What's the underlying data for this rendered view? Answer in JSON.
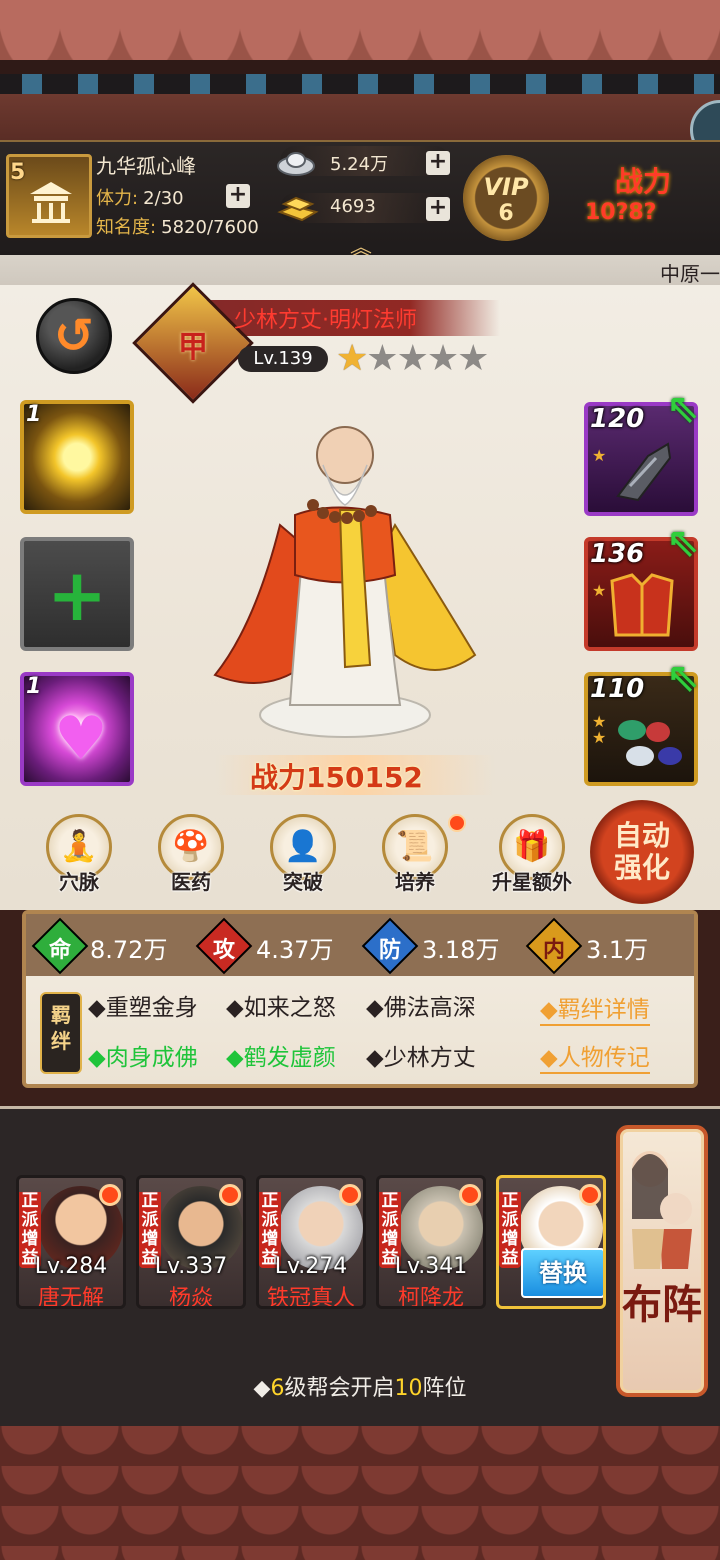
{
  "player": {
    "level": "5",
    "name": "九华孤心峰",
    "stamina_label": "体力:",
    "stamina_value": "2/30",
    "fame_label": "知名度:",
    "fame_value": "5820/7600"
  },
  "currency": {
    "silver": "5.24万",
    "gold": "4693"
  },
  "vip": {
    "label": "VIP",
    "level": "6"
  },
  "top_power": {
    "label": "战力",
    "value": "10?8?"
  },
  "region": "中原一",
  "hero": {
    "rank": "甲",
    "title": "少林方丈·明灯法师",
    "level": "Lv.139",
    "stars_on": 1,
    "stars_total": 5,
    "power_label": "战力",
    "power_value": "150152"
  },
  "skill_slots": [
    {
      "name": "gold-skill",
      "count": "1"
    },
    {
      "name": "empty-skill",
      "count": ""
    },
    {
      "name": "heart-skill",
      "count": "1"
    }
  ],
  "equipment": [
    {
      "name": "gauntlet",
      "level": "120",
      "stars": 1
    },
    {
      "name": "armor",
      "level": "136",
      "stars": 1
    },
    {
      "name": "gems",
      "level": "110",
      "stars": 2
    }
  ],
  "functions": [
    {
      "label": "穴脉",
      "icon": "meridian-icon",
      "dot": false
    },
    {
      "label": "医药",
      "icon": "medicine-icon",
      "dot": false
    },
    {
      "label": "突破",
      "icon": "breakthrough-icon",
      "dot": false
    },
    {
      "label": "培养",
      "icon": "training-scroll-icon",
      "dot": true
    },
    {
      "label": "升星额外",
      "icon": "star-up-icon",
      "dot": false
    }
  ],
  "auto_strengthen": {
    "line1": "自动",
    "line2": "强化"
  },
  "stats": [
    {
      "char": "命",
      "value": "8.72万",
      "color": "#2fae3c"
    },
    {
      "char": "攻",
      "value": "4.37万",
      "color": "#c92a22"
    },
    {
      "char": "防",
      "value": "3.18万",
      "color": "#2c6fc9"
    },
    {
      "char": "内",
      "value": "3.1万",
      "color": "#d99a1c"
    }
  ],
  "bonds": {
    "icon_line1": "羁",
    "icon_line2": "绊",
    "row1": [
      {
        "text": "◆重塑金身",
        "active": false
      },
      {
        "text": "◆如来之怒",
        "active": false
      },
      {
        "text": "◆佛法高深",
        "active": false
      }
    ],
    "row2": [
      {
        "text": "◆肉身成佛",
        "active": true
      },
      {
        "text": "◆鹤发虚颜",
        "active": true
      },
      {
        "text": "◆少林方丈",
        "active": false
      }
    ],
    "link1": "◆羁绊详情",
    "link2": "◆人物传记"
  },
  "lineup": [
    {
      "tag": "正派增益",
      "level": "Lv.284",
      "name": "唐无解"
    },
    {
      "tag": "正派增益",
      "level": "Lv.337",
      "name": "杨焱"
    },
    {
      "tag": "正派增益",
      "level": "Lv.274",
      "name": "铁冠真人"
    },
    {
      "tag": "正派增益",
      "level": "Lv.341",
      "name": "柯降龙"
    },
    {
      "tag": "正派增益",
      "level": "",
      "name": ""
    }
  ],
  "replace_label": "替换",
  "formation_label": "布阵",
  "unlock_tip": {
    "pre": "◆",
    "n1": "6",
    "mid": "级帮会开启",
    "n2": "10",
    "post": "阵位"
  }
}
